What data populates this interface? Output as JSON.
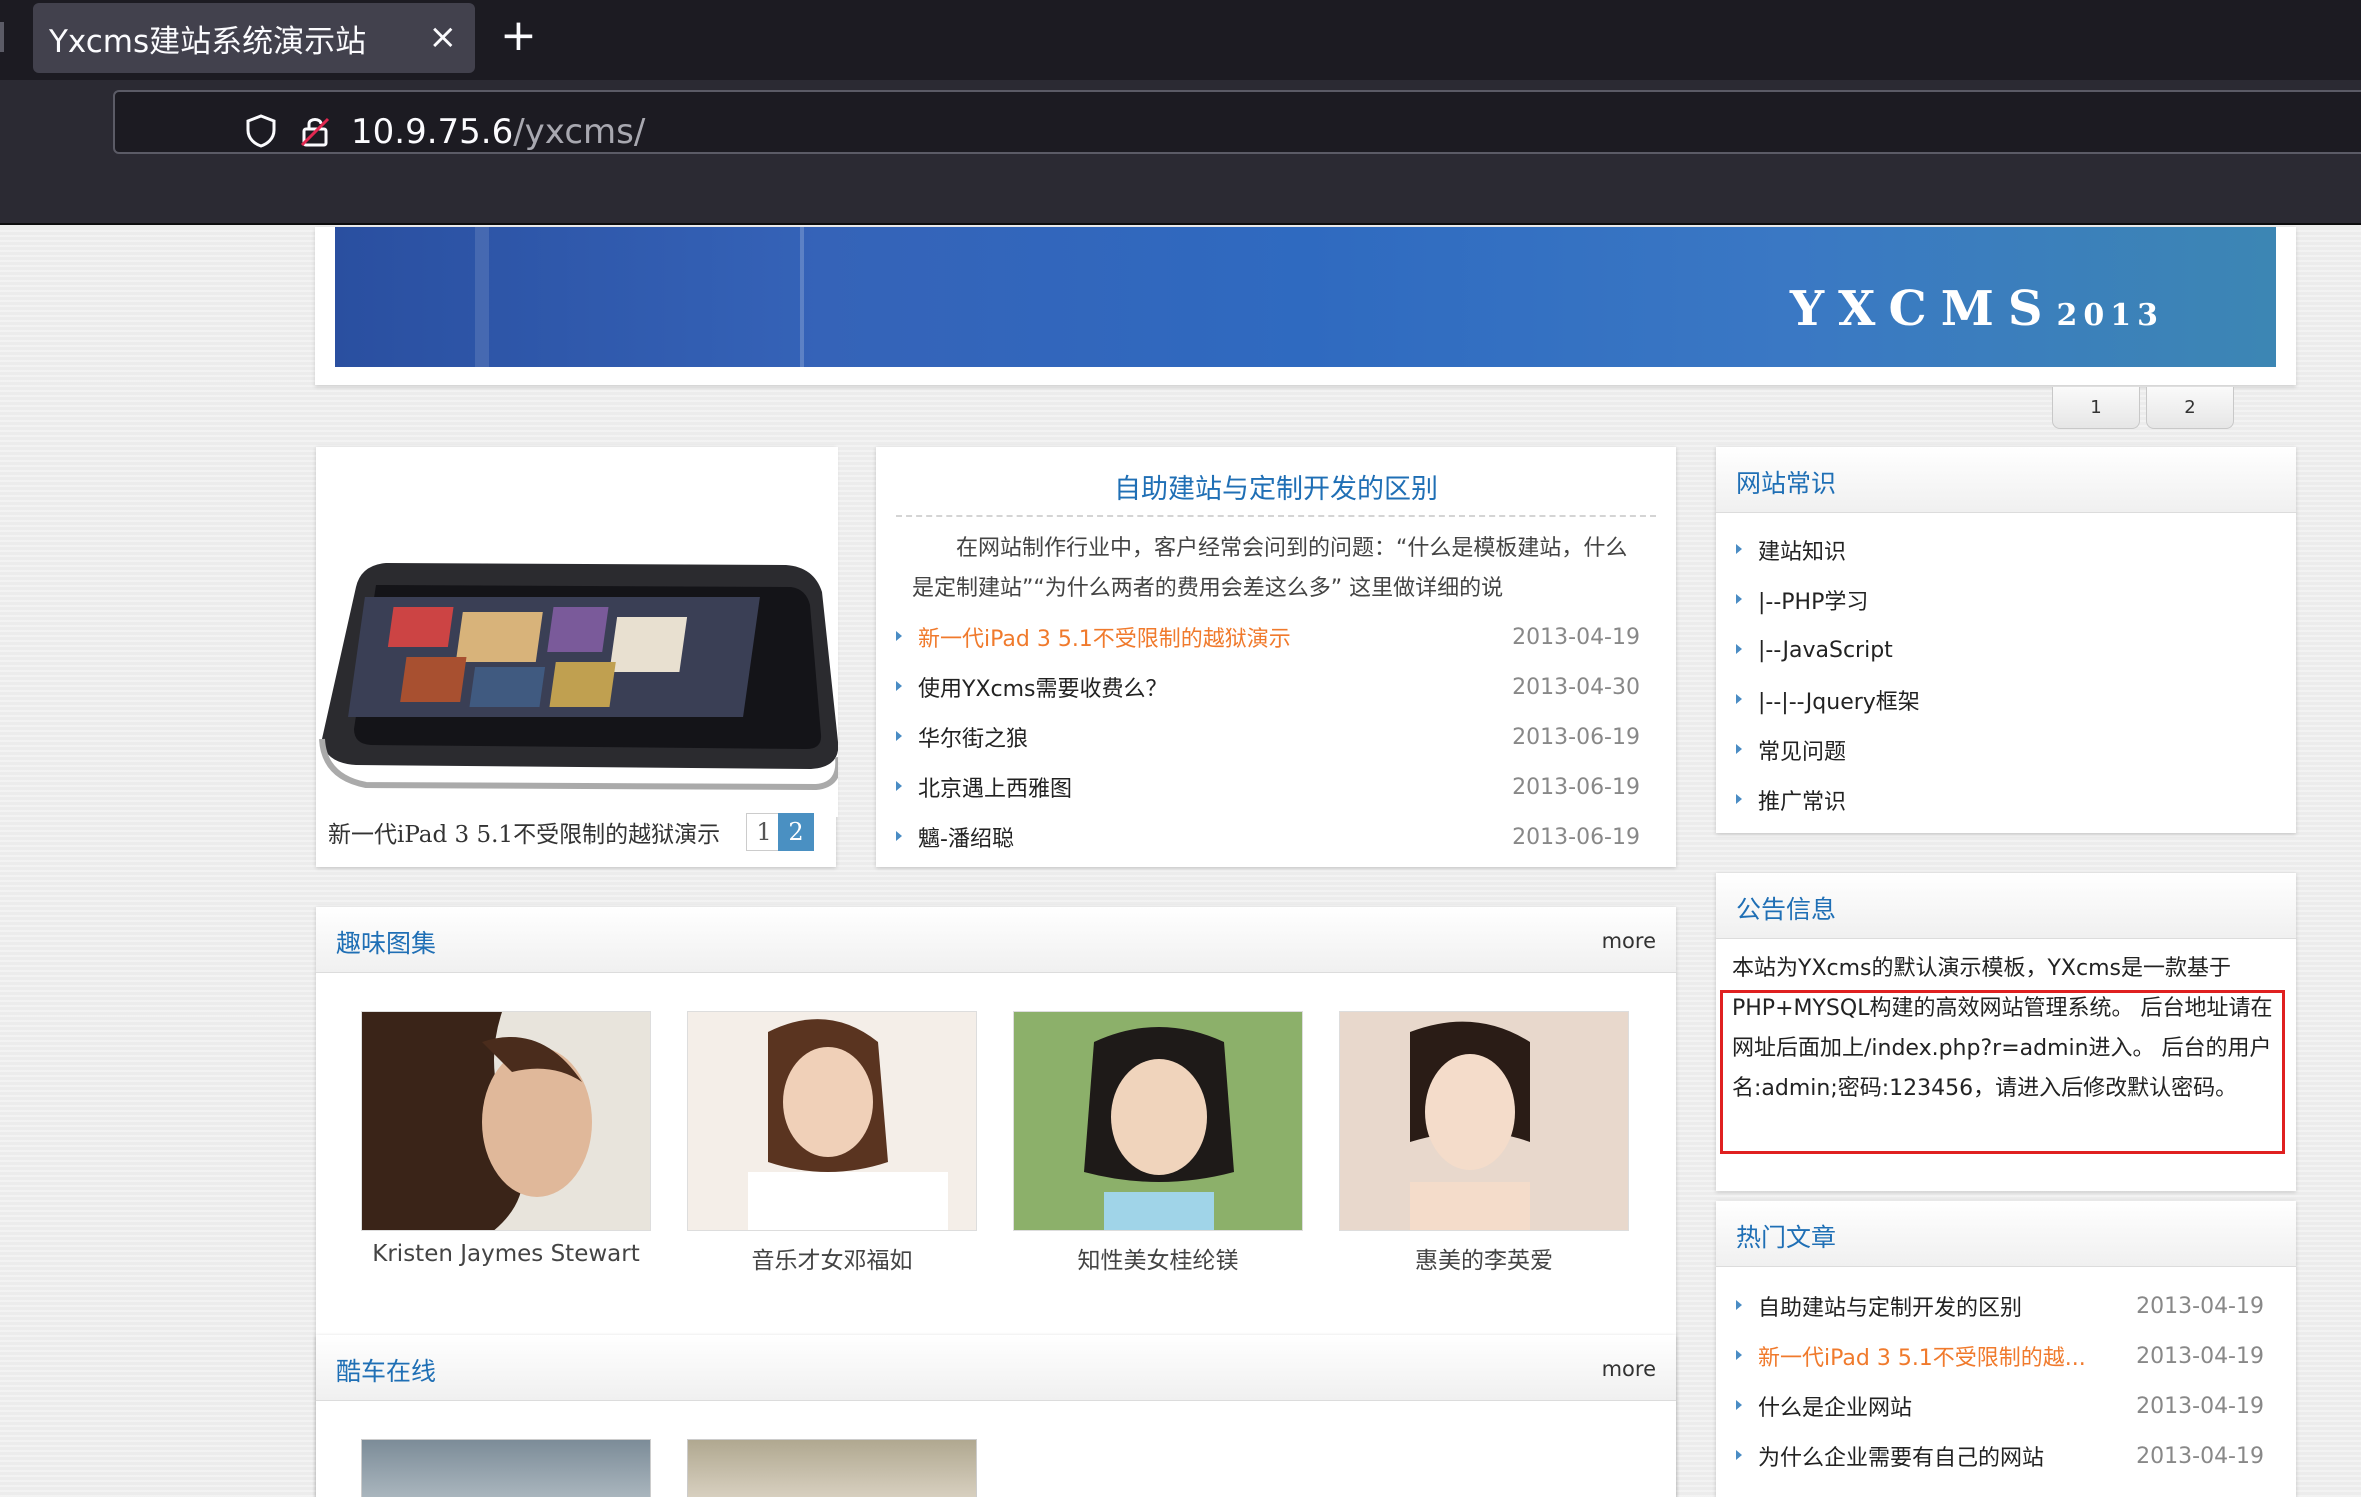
{
  "browser": {
    "tab_title": "Yxcms建站系统演示站",
    "tab_close": "×",
    "new_tab": "+",
    "url_host": "10.9.75.6",
    "url_path": "/yxcms/"
  },
  "banner": {
    "logo": "YXCMS",
    "logo_year": "2013",
    "pages": [
      "1",
      "2"
    ]
  },
  "featured": {
    "caption": "新一代iPad 3 5.1不受限制的越狱演示",
    "pages": [
      "1",
      "2"
    ]
  },
  "headline": {
    "title": "自助建站与定制开发的区别",
    "desc": "在网站制作行业中，客户经常会问到的问题：“什么是模板建站，什么是定制建站”“为什么两者的费用会差这么多” 这里做详细的说",
    "items": [
      {
        "title": "新一代iPad 3 5.1不受限制的越狱演示",
        "date": "2013-04-19",
        "hot": true
      },
      {
        "title": "使用YXcms需要收费么？",
        "date": "2013-04-30",
        "hot": false
      },
      {
        "title": "华尔街之狼",
        "date": "2013-06-19",
        "hot": false
      },
      {
        "title": "北京遇上西雅图",
        "date": "2013-06-19",
        "hot": false
      },
      {
        "title": "魑-潘绍聪",
        "date": "2013-06-19",
        "hot": false
      }
    ]
  },
  "gallery": {
    "title": "趣味图集",
    "more": "more",
    "items": [
      {
        "caption": "Kristen Jaymes Stewart"
      },
      {
        "caption": "音乐才女邓福如"
      },
      {
        "caption": "知性美女桂纶镁"
      },
      {
        "caption": "惠美的李英爱"
      }
    ]
  },
  "cars": {
    "title": "酷车在线",
    "more": "more"
  },
  "knowledge": {
    "title": "网站常识",
    "items": [
      "建站知识",
      "|--PHP学习",
      "|--JavaScript",
      "|--|--Jquery框架",
      "常见问题",
      "推广常识"
    ]
  },
  "notice": {
    "title": "公告信息",
    "text": "本站为YXcms的默认演示模板，YXcms是一款基于PHP+MYSQL构建的高效网站管理系统。 后台地址请在网址后面加上/index.php?r=admin进入。 后台的用户名:admin;密码:123456，请进入后修改默认密码。"
  },
  "hot_articles": {
    "title": "热门文章",
    "items": [
      {
        "title": "自助建站与定制开发的区别",
        "date": "2013-04-19",
        "hot": false
      },
      {
        "title": "新一代iPad 3 5.1不受限制的越...",
        "date": "2013-04-19",
        "hot": true
      },
      {
        "title": "什么是企业网站",
        "date": "2013-04-19",
        "hot": false
      },
      {
        "title": "为什么企业需要有自己的网站",
        "date": "2013-04-19",
        "hot": false
      }
    ]
  },
  "colors": {
    "link_blue": "#1f6fb5",
    "hot_orange": "#f07a2c",
    "highlight_red": "#e02020"
  }
}
